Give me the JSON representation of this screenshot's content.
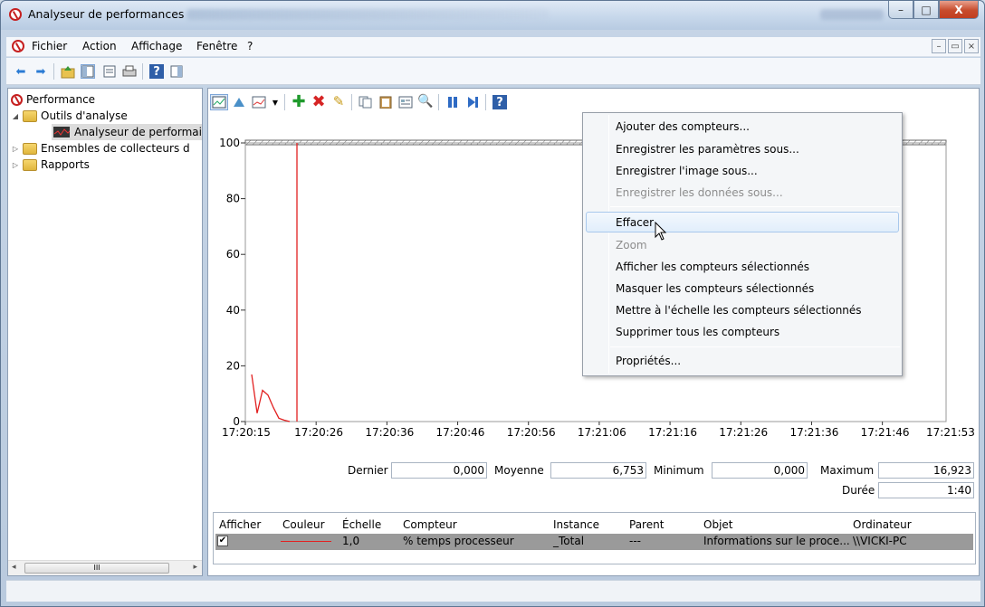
{
  "window": {
    "title": "Analyseur de performances",
    "controls": {
      "minimize": "–",
      "maximize": "□",
      "close": "X"
    }
  },
  "menubar": {
    "items": [
      "Fichier",
      "Action",
      "Affichage",
      "Fenêtre",
      "?"
    ],
    "mdi": [
      "–",
      "▭",
      "×"
    ]
  },
  "tree": {
    "items": [
      {
        "label": "Performance",
        "level": 0
      },
      {
        "label": "Outils d'analyse",
        "level": 1
      },
      {
        "label": "Analyseur de performai",
        "level": 2
      },
      {
        "label": "Ensembles de collecteurs d",
        "level": 1
      },
      {
        "label": "Rapports",
        "level": 1
      }
    ],
    "scroll": {
      "left": "◂",
      "right": "▸",
      "thumb": "III"
    }
  },
  "chart_data": {
    "type": "line",
    "ylim": [
      0,
      100
    ],
    "yticks": [
      "100",
      "80",
      "60",
      "40",
      "20",
      "0"
    ],
    "xticks": [
      "17:20:15",
      "17:20:26",
      "17:20:36",
      "17:20:46",
      "17:20:56",
      "17:21:06",
      "17:21:16",
      "17:21:26",
      "17:21:36",
      "17:21:46",
      "17:21:53"
    ],
    "series": [
      {
        "color": "#e22020",
        "values": [
          16.9,
          3.0,
          11.2,
          9.5,
          5.0,
          1.2,
          0.5,
          0.0
        ]
      }
    ],
    "marker_at_index": 8
  },
  "stats": {
    "last_label": "Dernier",
    "last_value": "0,000",
    "avg_label": "Moyenne",
    "avg_value": "6,753",
    "min_label": "Minimum",
    "min_value": "0,000",
    "max_label": "Maximum",
    "max_value": "16,923",
    "dur_label": "Durée",
    "dur_value": "1:40"
  },
  "legend": {
    "headers": [
      "Afficher",
      "Couleur",
      "Échelle",
      "Compteur",
      "Instance",
      "Parent",
      "Objet",
      "Ordinateur"
    ],
    "row": {
      "checked": "✔",
      "color": "#e22020",
      "scale": "1,0",
      "counter": "% temps processeur",
      "instance": "_Total",
      "parent": "---",
      "object": "Informations sur le proce...",
      "computer": "\\\\VICKI-PC"
    }
  },
  "context_menu": {
    "items": [
      {
        "label": "Ajouter des compteurs...",
        "disabled": false
      },
      {
        "label": "Enregistrer les paramètres sous...",
        "disabled": false
      },
      {
        "label": "Enregistrer l'image sous...",
        "disabled": false
      },
      {
        "label": "Enregistrer les données sous...",
        "disabled": true
      },
      {
        "label": "Effacer",
        "disabled": false,
        "highlighted": true
      },
      {
        "label": "Zoom",
        "disabled": true
      },
      {
        "label": "Afficher les compteurs sélectionnés",
        "disabled": false
      },
      {
        "label": "Masquer les compteurs sélectionnés",
        "disabled": false
      },
      {
        "label": "Mettre à l'échelle les compteurs sélectionnés",
        "disabled": false
      },
      {
        "label": "Supprimer tous les compteurs",
        "disabled": false
      },
      {
        "label": "Propriétés...",
        "disabled": false
      }
    ]
  },
  "icons": {
    "back": "arrow-left-icon",
    "forward": "arrow-right-icon",
    "add": "plus-icon",
    "delete": "x-icon",
    "help": "question-icon"
  }
}
